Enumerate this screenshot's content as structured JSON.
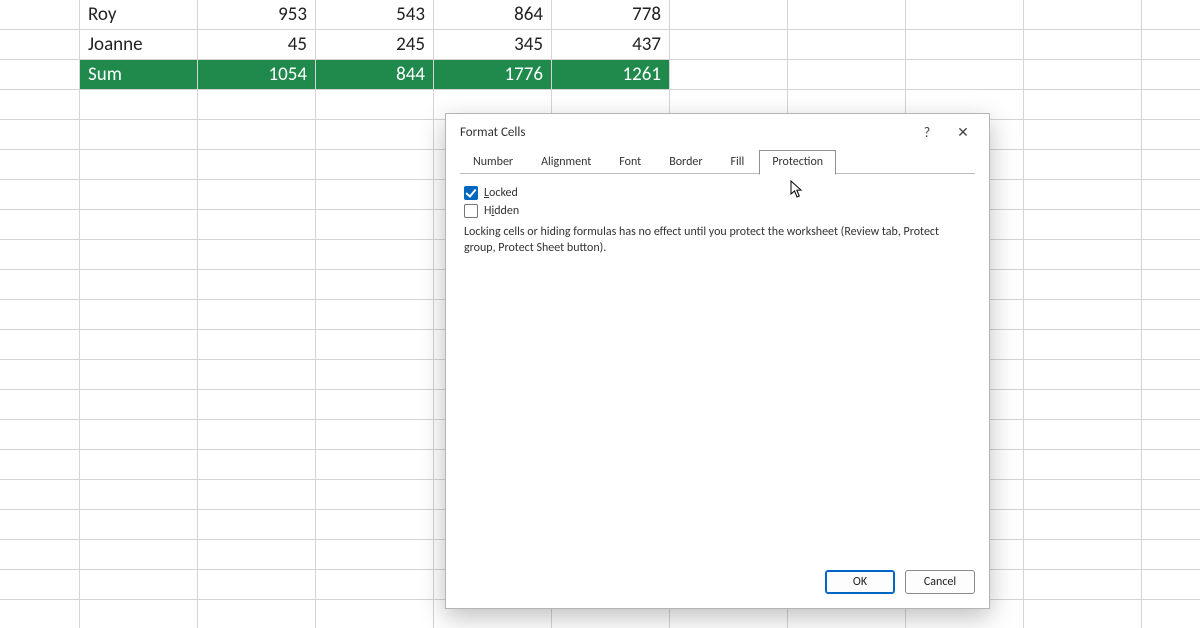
{
  "spreadsheet": {
    "rows": [
      {
        "label": "Roy",
        "vals": [
          "953",
          "543",
          "864",
          "778"
        ],
        "sum": false
      },
      {
        "label": "Joanne",
        "vals": [
          "45",
          "245",
          "345",
          "437"
        ],
        "sum": false
      },
      {
        "label": "Sum",
        "vals": [
          "1054",
          "844",
          "1776",
          "1261"
        ],
        "sum": true
      }
    ]
  },
  "dialog": {
    "title": "Format Cells",
    "help_tip": "?",
    "close_tip": "✕",
    "tabs": {
      "number": "Number",
      "alignment": "Alignment",
      "font": "Font",
      "border": "Border",
      "fill": "Fill",
      "protection": "Protection"
    },
    "protection": {
      "locked_label": "Locked",
      "locked_accel": "L",
      "hidden_label": "Hidden",
      "hidden_accel": "i",
      "info": "Locking cells or hiding formulas has no effect until you protect the worksheet (Review tab, Protect group, Protect Sheet button)."
    },
    "buttons": {
      "ok": "OK",
      "cancel": "Cancel"
    }
  }
}
